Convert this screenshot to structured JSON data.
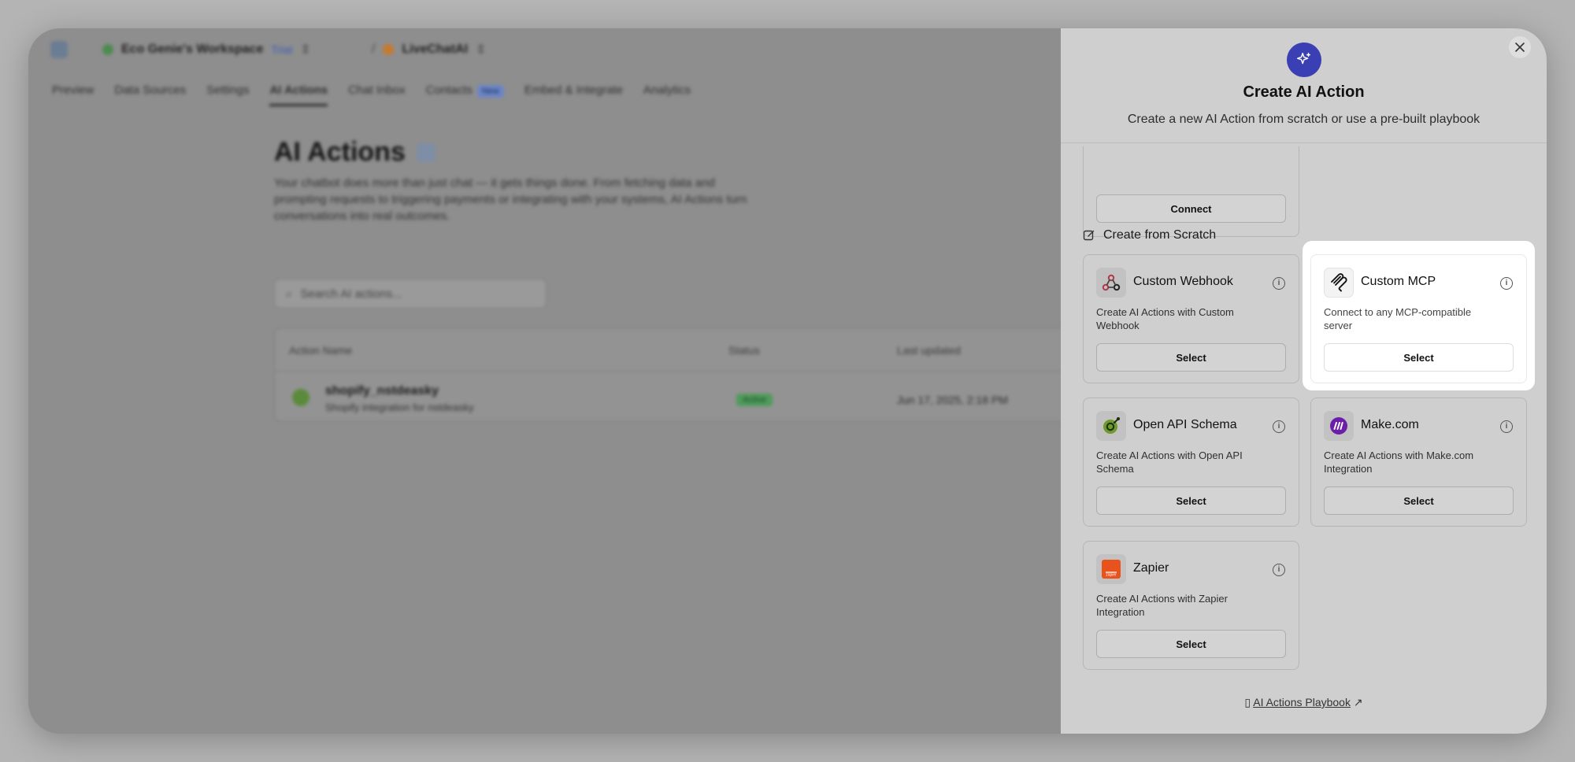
{
  "background": {
    "workspace_name": "Eco Genie's Workspace",
    "workspace_plan": "Trial",
    "project_name": "LiveChatAI",
    "nav_tabs": [
      "Preview",
      "Data Sources",
      "Settings",
      "AI Actions",
      "Chat Inbox",
      "Contacts",
      "Embed & Integrate",
      "Analytics"
    ],
    "new_badge": "New",
    "page_title": "AI Actions",
    "page_description": "Your chatbot does more than just chat — it gets things done. From fetching data and prompting requests to triggering payments or integrating with your systems, AI Actions turn conversations into real outcomes.",
    "search_placeholder": "Search AI actions...",
    "table_headers": [
      "Action Name",
      "Status",
      "Last updated"
    ],
    "rows": [
      {
        "name": "shopify_nstdeasky",
        "subtitle": "Shopify integration for nstdeasky",
        "status": "Active",
        "updated": "Jun 17, 2025, 2:18 PM"
      }
    ]
  },
  "panel": {
    "title": "Create AI Action",
    "subtitle": "Create a new AI Action from scratch or use a pre-built playbook",
    "connect_label": "Connect",
    "section_title": "Create from Scratch",
    "cards": [
      {
        "title": "Custom Webhook",
        "description": "Create AI Actions with Custom Webhook",
        "button": "Select",
        "icon": "webhook-icon"
      },
      {
        "title": "Custom MCP",
        "description": "Connect to any MCP-compatible server",
        "button": "Select",
        "icon": "mcp-icon"
      },
      {
        "title": "Open API Schema",
        "description": "Create AI Actions with Open API Schema",
        "button": "Select",
        "icon": "openapi-icon"
      },
      {
        "title": "Make.com",
        "description": "Create AI Actions with Make.com Integration",
        "button": "Select",
        "icon": "make-icon"
      },
      {
        "title": "Zapier",
        "description": "Create AI Actions with Zapier Integration",
        "button": "Select",
        "icon": "zapier-icon"
      }
    ],
    "footer_link": "AI Actions Playbook",
    "colors": {
      "accent": "#3a3fb3",
      "highlight": "#ffffff",
      "zapier": "#e8521c",
      "make": "#6d1ea8"
    }
  }
}
